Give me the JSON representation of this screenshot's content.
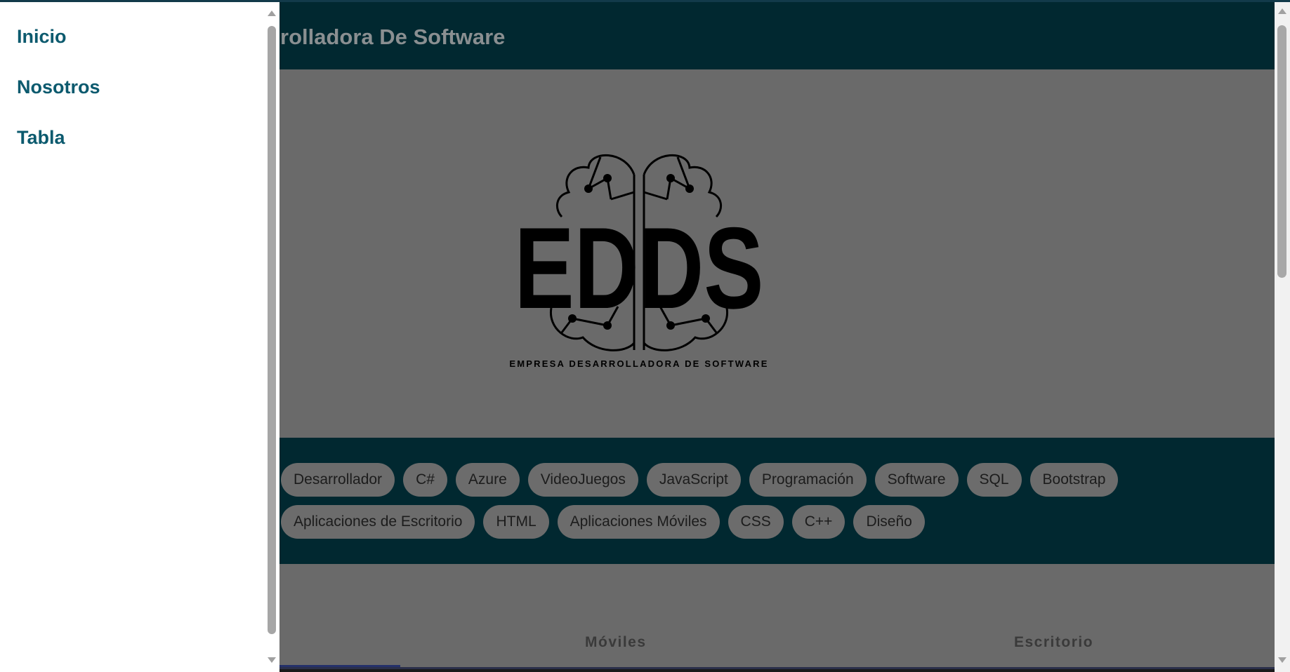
{
  "header": {
    "title": "rolladora De Software"
  },
  "hero": {
    "logo_text": "EDDS",
    "logo_caption": "EMPRESA DESARROLLADORA DE SOFTWARE"
  },
  "tags": {
    "row1": [
      "Desarrollador",
      "C#",
      "Azure",
      "VideoJuegos",
      "JavaScript",
      "Programación",
      "Software",
      "SQL",
      "Bootstrap"
    ],
    "row2": [
      "Aplicaciones de Escritorio",
      "HTML",
      "Aplicaciones Móviles",
      "CSS",
      "C++",
      "Diseño"
    ]
  },
  "tabs": {
    "moviles": "Móviles",
    "escritorio": "Escritorio"
  },
  "drawer": {
    "items": [
      {
        "label": "Inicio"
      },
      {
        "label": "Nosotros"
      },
      {
        "label": "Tabla"
      }
    ]
  },
  "colors": {
    "header_bg": "#012830",
    "drawer_link": "#0c5a6e",
    "overlay_bg": "#6a6a6a"
  }
}
